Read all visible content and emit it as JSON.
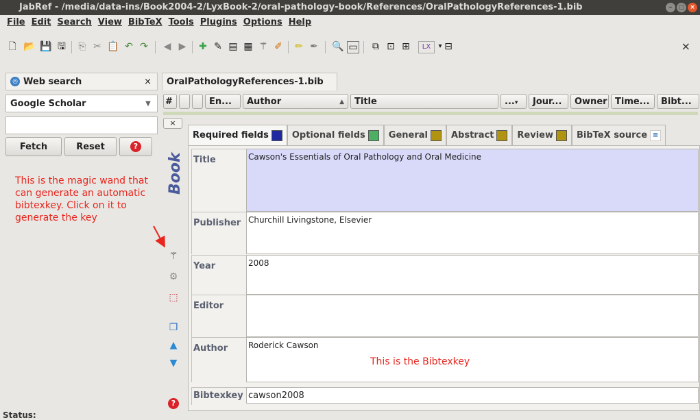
{
  "window": {
    "title": "JabRef - /media/data-ins/Book2004-2/LyxBook-2/oral-pathology-book/References/OralPathologyReferences-1.bib"
  },
  "menu": [
    "File",
    "Edit",
    "Search",
    "View",
    "BibTeX",
    "Tools",
    "Plugins",
    "Options",
    "Help"
  ],
  "toolbar_icons": [
    "new-database-icon",
    "open-icon",
    "save-icon",
    "save-all-icon",
    "copy-icon",
    "cut-icon",
    "paste-icon",
    "undo-icon",
    "redo-icon",
    "back-icon",
    "forward-icon",
    "new-entry-icon",
    "edit-entry-icon",
    "edit-preamble-icon",
    "edit-strings-icon",
    "autogenerate-key-icon",
    "cleanup-icon",
    "mark-entries-icon",
    "unmark-icon",
    "search-icon",
    "preview-icon",
    "toggle-groups-icon",
    "open-pdf-icon",
    "open-url-icon",
    "push-lyx-icon",
    "integrity-icon"
  ],
  "web_search": {
    "title": "Web search",
    "engine": "Google Scholar",
    "query": "",
    "fetch_label": "Fetch",
    "reset_label": "Reset"
  },
  "database_tab": "OralPathologyReferences-1.bib",
  "columns": [
    "#",
    "",
    "",
    "En...",
    "Author",
    "Title",
    "...",
    "Jour...",
    "Owner",
    "Time...",
    "Bibt..."
  ],
  "entry_type": "Book",
  "tabs": [
    {
      "label": "Required fields",
      "color": "#1f2aa0"
    },
    {
      "label": "Optional fields",
      "color": "#4caf63"
    },
    {
      "label": "General",
      "color": "#b19312"
    },
    {
      "label": "Abstract",
      "color": "#b19312"
    },
    {
      "label": "Review",
      "color": "#b19312"
    },
    {
      "label": "BibTeX source",
      "color": "#ffffff"
    }
  ],
  "fields": {
    "title": {
      "label": "Title",
      "value": "Cawson's Essentials of Oral Pathology and Oral Medicine"
    },
    "publisher": {
      "label": "Publisher",
      "value": "Churchill Livingstone, Elsevier"
    },
    "year": {
      "label": "Year",
      "value": "2008"
    },
    "editor": {
      "label": "Editor",
      "value": ""
    },
    "author": {
      "label": "Author",
      "value": "Roderick Cawson"
    },
    "bibtexkey": {
      "label": "Bibtexkey",
      "value": "cawson2008"
    }
  },
  "annotations": {
    "magic_wand": "This is the magic wand that can generate an automatic bibtexkey. Click on it to generate the key",
    "bibtexkey": "This is the Bibtexkey"
  },
  "status": "Status:"
}
